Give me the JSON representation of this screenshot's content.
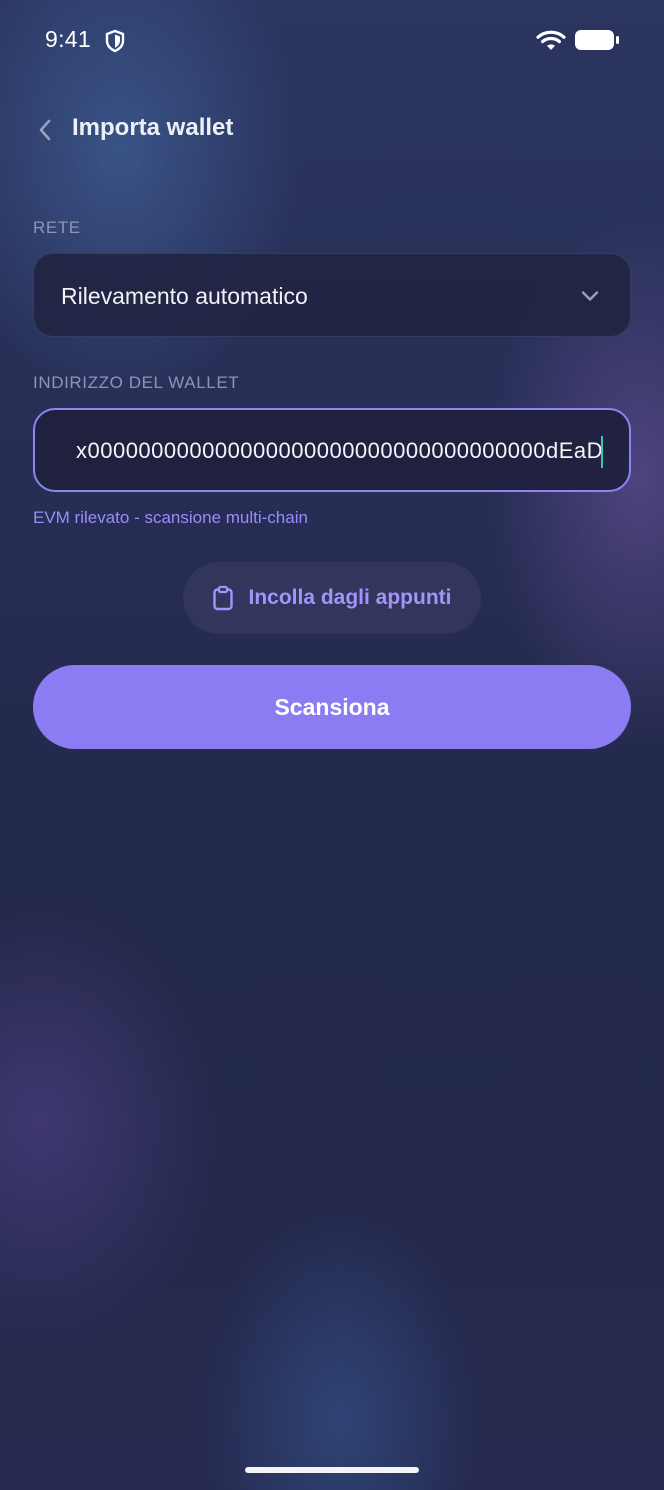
{
  "status_bar": {
    "time": "9:41",
    "icons": [
      "shield-icon",
      "wifi-icon",
      "battery-icon"
    ]
  },
  "header": {
    "back_icon": "chevron-left-icon",
    "title": "Importa wallet"
  },
  "network": {
    "label": "RETE",
    "selected_value": "Rilevamento automatico",
    "dropdown_icon": "chevron-down-icon"
  },
  "wallet": {
    "label": "INDIRIZZO DEL WALLET",
    "address_visible": "x000000000000000000000000000000000000dEaD",
    "hint": "EVM rilevato - scansione multi-chain"
  },
  "actions": {
    "paste_label": "Incolla dagli appunti",
    "paste_icon": "clipboard-icon",
    "scan_label": "Scansiona"
  },
  "colors": {
    "accent": "#8c7cf3",
    "accent_text": "#a294fb",
    "caret": "#3bc3b0",
    "background_dark": "#232849"
  }
}
